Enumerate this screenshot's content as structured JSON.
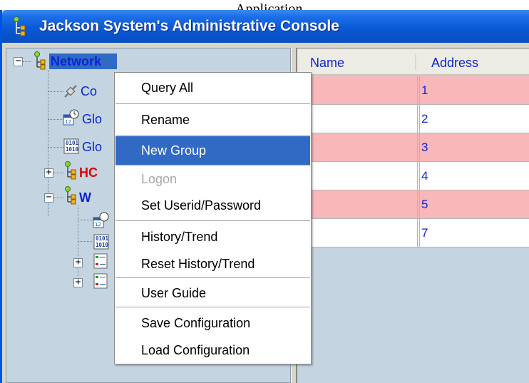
{
  "window": {
    "tab_caption": "Application",
    "title": "Jackson System's Administrative Console"
  },
  "tree": {
    "root": {
      "label": "Network",
      "expander": "−"
    },
    "children": [
      {
        "label": "Co",
        "icon": "connection-icon",
        "color": "#0a26d6"
      },
      {
        "label": "Glo",
        "icon": "clock-calendar-icon",
        "color": "#0a26d6"
      },
      {
        "label": "Glo",
        "icon": "binary-data-icon",
        "color": "#0a26d6"
      },
      {
        "label": "HC",
        "icon": "network-node-icon",
        "color": "#e00000",
        "expander": "+"
      },
      {
        "label": "W",
        "icon": "network-node-icon",
        "color": "#0a26d6",
        "expander": "−"
      }
    ],
    "subchildren": [
      {
        "icon": "clock-calendar-icon"
      },
      {
        "icon": "binary-data-icon"
      },
      {
        "icon": "list-icon",
        "expander": "+"
      },
      {
        "icon": "list-icon",
        "expander": "+"
      }
    ]
  },
  "table": {
    "columns": [
      "Name",
      "Address"
    ],
    "rows": [
      {
        "name": "",
        "address": "1",
        "highlight": true
      },
      {
        "name": "",
        "address": "2",
        "highlight": false
      },
      {
        "name": "",
        "address": "3",
        "highlight": true
      },
      {
        "name": "",
        "address": "4",
        "highlight": false
      },
      {
        "name": "",
        "address": "5",
        "highlight": true
      },
      {
        "name": "",
        "address": "7",
        "highlight": false
      }
    ]
  },
  "context_menu": {
    "items": [
      {
        "label": "Query All"
      },
      {
        "label": "Rename"
      },
      {
        "label": "New Group",
        "selected": true
      },
      {
        "label": "Logon",
        "disabled": true
      },
      {
        "label": "Set Userid/Password"
      },
      {
        "label": "History/Trend"
      },
      {
        "label": "Reset History/Trend"
      },
      {
        "label": "User Guide"
      },
      {
        "label": "Save Configuration"
      },
      {
        "label": "Load Configuration"
      }
    ]
  },
  "colors": {
    "titlebar": "#0a5ad8",
    "tree_background": "#c4d4e1",
    "menu_selection": "#316ac5",
    "row_highlight": "#f8b8b9",
    "link_blue": "#0a26d6"
  }
}
